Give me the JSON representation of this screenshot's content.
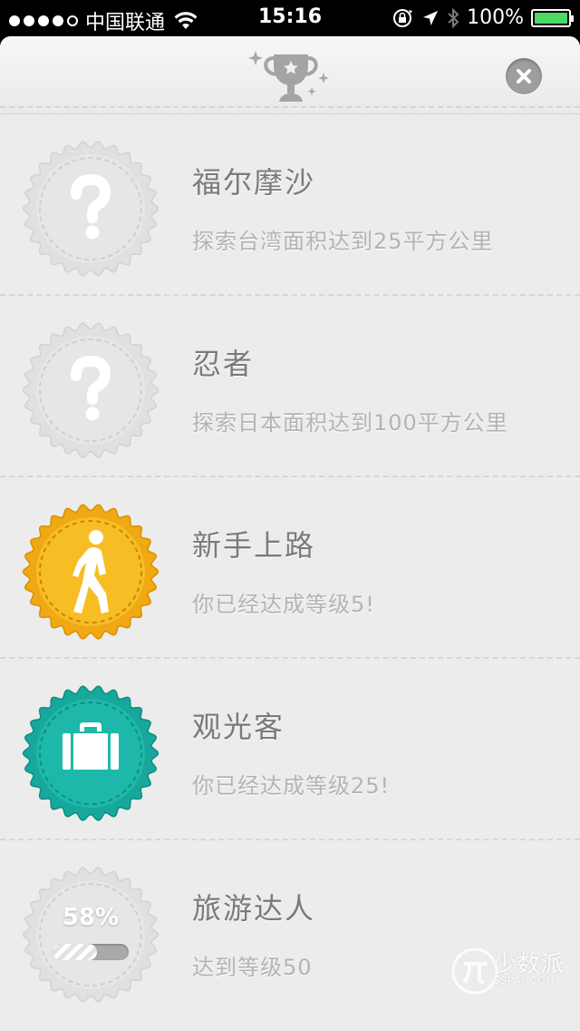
{
  "status_bar": {
    "carrier": "中国联通",
    "time": "15:16",
    "battery_percent": "100%",
    "battery_level": 1.0,
    "signal_bars_filled": 4
  },
  "header": {
    "icon": "trophy-icon",
    "close_icon": "close-icon"
  },
  "achievements": [
    {
      "title": "福尔摩沙",
      "description": "探索台湾面积达到25平方公里",
      "state": "locked",
      "icon": "question-mark-icon"
    },
    {
      "title": "忍者",
      "description": "探索日本面积达到100平方公里",
      "state": "locked",
      "icon": "question-mark-icon"
    },
    {
      "title": "新手上路",
      "description": "你已经达成等级5!",
      "state": "unlocked",
      "icon": "walking-person-icon",
      "color": "#f5b819"
    },
    {
      "title": "观光客",
      "description": "你已经达成等级25!",
      "state": "unlocked",
      "icon": "suitcase-icon",
      "color": "#1eb3a6"
    },
    {
      "title": "旅游达人",
      "description": "达到等级50",
      "state": "in-progress",
      "progress_label": "58%",
      "progress": 0.58
    }
  ],
  "watermark": {
    "text": "少数派",
    "subtext": "SSPAI.COM"
  }
}
